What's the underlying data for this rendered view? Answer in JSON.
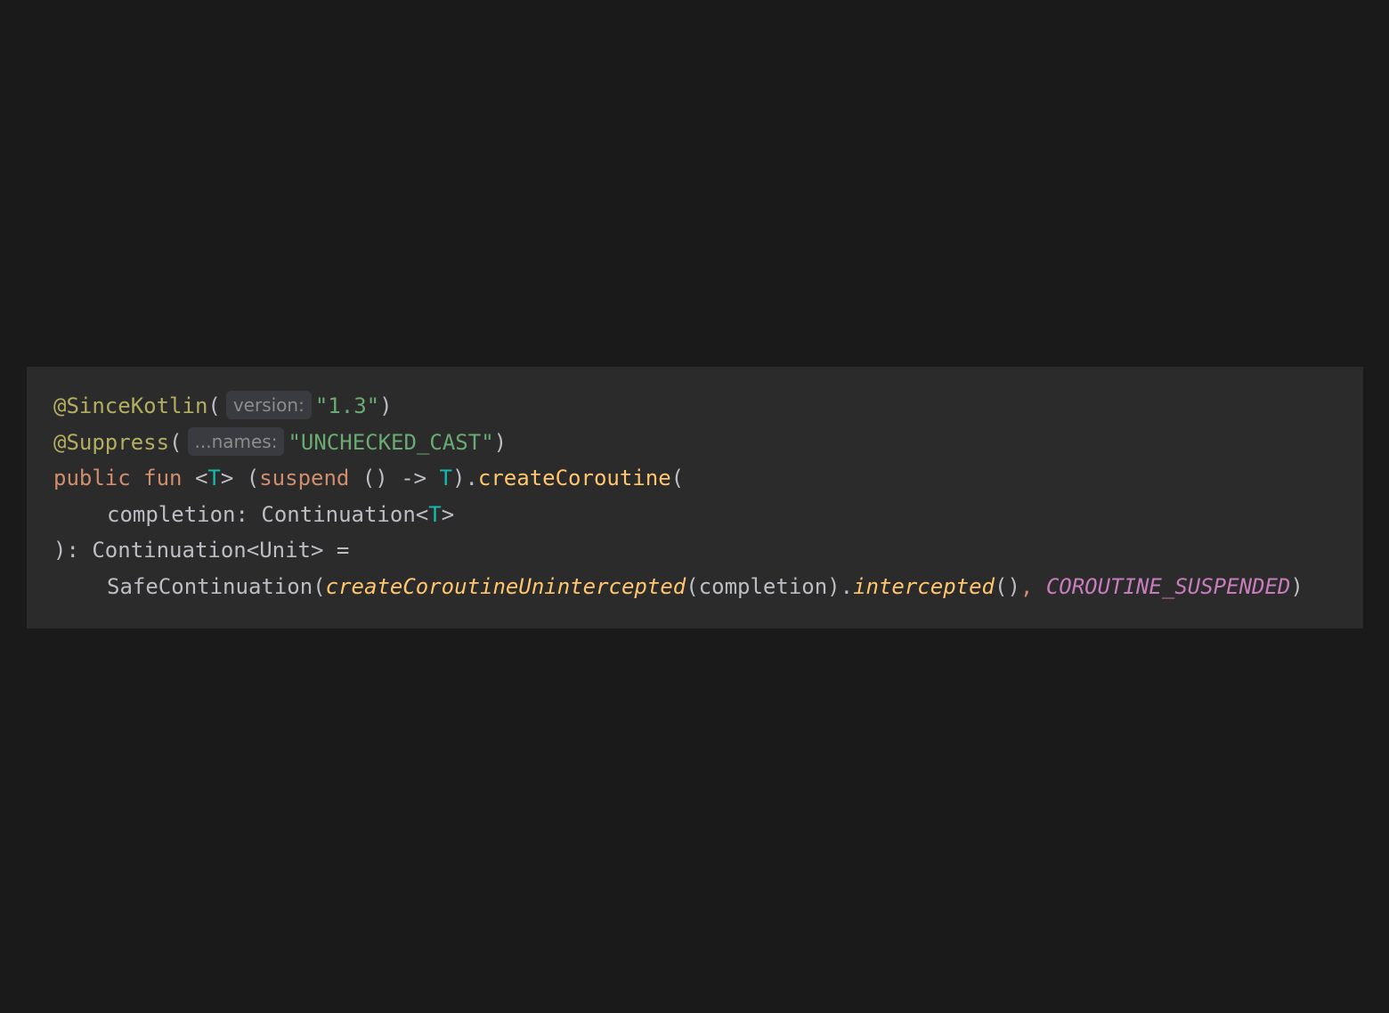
{
  "editor": {
    "lines": [
      {
        "tokens": [
          {
            "t": "@SinceKotlin",
            "c": "ann"
          },
          {
            "t": "(",
            "c": "punc"
          },
          {
            "t": "version:",
            "c": "hint"
          },
          {
            "t": "\"1.3\"",
            "c": "str"
          },
          {
            "t": ")",
            "c": "punc"
          }
        ]
      },
      {
        "tokens": [
          {
            "t": "@Suppress",
            "c": "ann"
          },
          {
            "t": "(",
            "c": "punc"
          },
          {
            "t": "...names:",
            "c": "hint"
          },
          {
            "t": "\"UNCHECKED_CAST\"",
            "c": "str"
          },
          {
            "t": ")",
            "c": "punc"
          }
        ]
      },
      {
        "tokens": [
          {
            "t": "public",
            "c": "kw"
          },
          {
            "t": " ",
            "c": "punc"
          },
          {
            "t": "fun",
            "c": "kw"
          },
          {
            "t": " <",
            "c": "punc"
          },
          {
            "t": "T",
            "c": "tp"
          },
          {
            "t": "> (",
            "c": "punc"
          },
          {
            "t": "suspend",
            "c": "kw"
          },
          {
            "t": " () -> ",
            "c": "punc"
          },
          {
            "t": "T",
            "c": "tp"
          },
          {
            "t": ").",
            "c": "punc"
          },
          {
            "t": "createCoroutine",
            "c": "fn"
          },
          {
            "t": "(",
            "c": "punc"
          }
        ]
      },
      {
        "indent": true,
        "tokens": [
          {
            "t": "completion: Continuation<",
            "c": "punc"
          },
          {
            "t": "T",
            "c": "tp"
          },
          {
            "t": ">",
            "c": "punc"
          }
        ]
      },
      {
        "tokens": [
          {
            "t": "): Continuation<Unit> =",
            "c": "punc"
          }
        ]
      },
      {
        "indent": true,
        "tokens": [
          {
            "t": "SafeContinuation(",
            "c": "punc"
          },
          {
            "t": "createCoroutineUnintercepted",
            "c": "fn-it"
          },
          {
            "t": "(completion).",
            "c": "punc"
          },
          {
            "t": "intercepted",
            "c": "fn-it"
          },
          {
            "t": "()",
            "c": "punc"
          },
          {
            "t": ", ",
            "c": "kw"
          },
          {
            "t": "COROUTINE_SUSPENDED",
            "c": "const"
          },
          {
            "t": ")",
            "c": "punc"
          }
        ]
      }
    ]
  }
}
